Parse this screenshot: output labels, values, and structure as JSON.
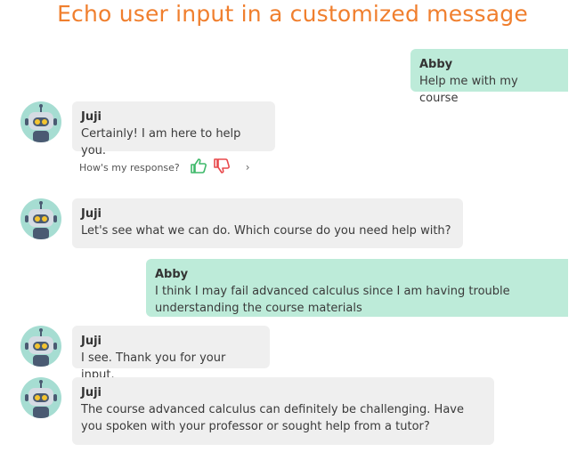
{
  "page": {
    "title": "Echo user input in a customized message"
  },
  "messages": [
    {
      "role": "user",
      "sender": "Abby",
      "text": "Help me with my course"
    },
    {
      "role": "bot",
      "sender": "Juji",
      "text": "Certainly! I am here to help you."
    },
    {
      "role": "bot",
      "sender": "Juji",
      "text": "Let's see what we can do. Which course do you need help with?"
    },
    {
      "role": "user",
      "sender": "Abby",
      "text": "I think I may fail advanced calculus since I am having trouble understanding the course materials"
    },
    {
      "role": "bot",
      "sender": "Juji",
      "text": "I see. Thank you for your input."
    },
    {
      "role": "bot",
      "sender": "Juji",
      "text": "The course advanced calculus can definitely be challenging. Have you spoken with your professor or sought help from a tutor?"
    }
  ],
  "feedback": {
    "label": "How's my response?",
    "icons": [
      "thumbs-up-icon",
      "thumbs-down-icon",
      "chevron-right-icon"
    ]
  },
  "colors": {
    "title": "#f07f2e",
    "user_bubble": "#bdebd9",
    "bot_bubble": "#efefef",
    "thumbs_up": "#3fb96a",
    "thumbs_down": "#e8484b"
  }
}
